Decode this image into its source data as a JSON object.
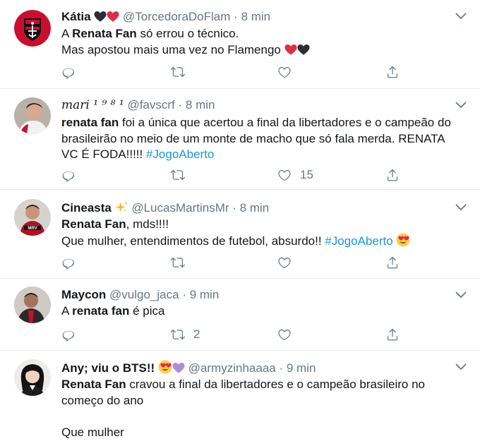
{
  "tweets": [
    {
      "name": "Kátia",
      "handle": "@TorcedoraDoFlam",
      "time": "8 min",
      "line1_pre": "A ",
      "line1_bold": "Renata Fan",
      "line1_post": " só errou o técnico.",
      "line2": "Mas apostou mais uma vez no Flamengo"
    },
    {
      "name": "mari",
      "name_suffix": "¹ ⁹ ⁸ ¹",
      "handle": "@favscrf",
      "time": "8 min",
      "bold": "renata fan",
      "line1_post": " foi a única que acertou a final da libertadores e o campeão do",
      "line2": "brasileirão no meio de um monte de macho que só fala merda. RENATA",
      "line3_pre": "VC É FODA!!!!! ",
      "hashtag": "#JogoAberto",
      "likes": "15"
    },
    {
      "name": "Cineasta",
      "handle": "@LucasMartinsMr",
      "time": "8 min",
      "bold": "Renata Fan",
      "line1_post": ", mds!!!!",
      "line2_pre": "Que mulher, entendimentos de futebol, absurdo!! ",
      "hashtag": "#JogoAberto"
    },
    {
      "name": "Maycon",
      "handle": "@vulgo_jaca",
      "time": "9 min",
      "line1_pre": "A ",
      "bold": "renata fan",
      "line1_post": " é pica",
      "retweets": "2"
    },
    {
      "name": "Any; viu o BTS!!",
      "handle": "@armyzinhaaaa",
      "time": "9 min",
      "bold": "Renata Fan",
      "line1_post": " cravou a final da libertadores e o campeão brasileiro no",
      "line2": "começo do ano",
      "line3": "Que mulher"
    }
  ],
  "separator": "·",
  "colors": {
    "link": "#1b95e0",
    "muted": "#657786",
    "border": "#e6ecf0",
    "heart_red": "#e0245e"
  }
}
